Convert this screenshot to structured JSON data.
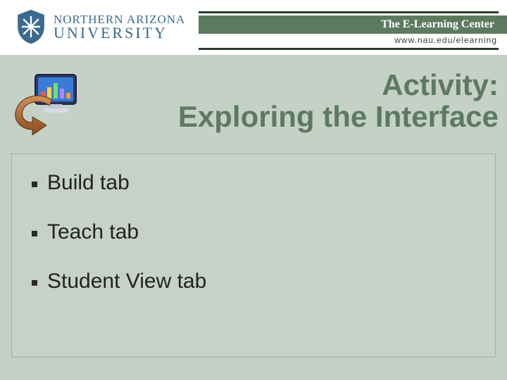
{
  "header": {
    "university_line1": "NORTHERN ARIZONA",
    "university_line2": "UNIVERSITY",
    "center_title": "The E-Learning Center",
    "url": "www.nau.edu/elearning"
  },
  "title": {
    "line1": "Activity:",
    "line2": "Exploring the Interface"
  },
  "bullets": [
    "Build tab",
    "Teach tab",
    "Student View tab"
  ],
  "colors": {
    "background": "#c5d1c6",
    "accent_green": "#5d7a61",
    "nau_blue": "#3a6a8f"
  }
}
